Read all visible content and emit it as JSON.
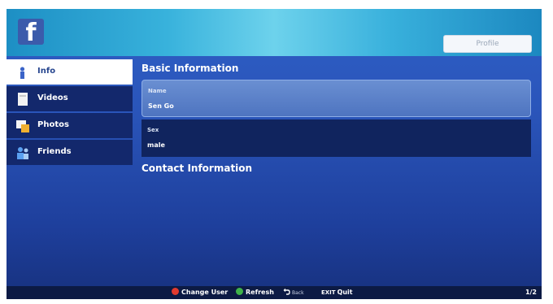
{
  "header": {
    "logo_letter": "f",
    "profile_label": "Profile"
  },
  "sidebar": {
    "items": [
      {
        "label": "Info",
        "icon": "info-person-icon",
        "active": true
      },
      {
        "label": "Videos",
        "icon": "video-icon",
        "active": false
      },
      {
        "label": "Photos",
        "icon": "photos-icon",
        "active": false
      },
      {
        "label": "Friends",
        "icon": "friends-icon",
        "active": false
      }
    ]
  },
  "main": {
    "basic_title": "Basic Information",
    "fields": [
      {
        "label": "Name",
        "value": "Sen Go"
      },
      {
        "label": "Sex",
        "value": "male"
      }
    ],
    "contact_title": "Contact Information"
  },
  "footer": {
    "change_user": "Change User",
    "refresh": "Refresh",
    "back": "Back",
    "exit_key": "EXIT",
    "quit": "Quit",
    "page": "1/2"
  },
  "colors": {
    "red_button": "#e23a2e",
    "green_button": "#3fb34a",
    "facebook_blue": "#3b5bab"
  }
}
